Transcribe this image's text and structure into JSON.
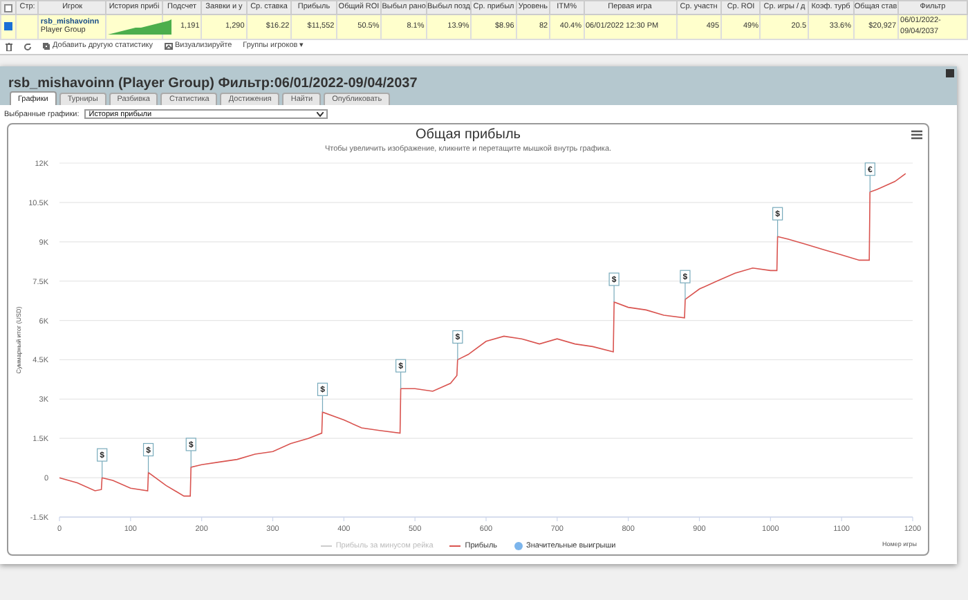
{
  "table": {
    "all_checked": false,
    "columns": [
      "Стр:",
      "Игрок",
      "История прибі",
      "Подсчет",
      "Заявки и у",
      "Ср. ставка",
      "Прибыль",
      "Общий ROI",
      "Выбыл рано",
      "Выбыл позд",
      "Ср. прибыл",
      "Уровень",
      "ITM%",
      "Первая игра",
      "Ср. участн",
      "Ср. ROI",
      "Ср. игры / д",
      "Коэф. турб",
      "Общая став",
      "Фильтр"
    ],
    "rows": [
      {
        "checked": true,
        "player": "rsb_mishavoinn",
        "group": "Player Group",
        "values": [
          "1,191",
          "1,290",
          "$16.22",
          "$11,552",
          "50.5%",
          "8.1%",
          "13.9%",
          "$8.96",
          "82",
          "40.4%",
          "06/01/2022 12:30 PM",
          "495",
          "49%",
          "20.5",
          "33.6%",
          "$20,927",
          "06/01/2022-09/04/2037"
        ]
      }
    ]
  },
  "toolbar": {
    "items": [
      {
        "kind": "trash"
      },
      {
        "kind": "refresh"
      },
      {
        "kind": "add",
        "label": "Добавить другую статистику"
      },
      {
        "kind": "chart",
        "label": "Визуализируйте"
      },
      {
        "kind": "menu",
        "label": "Группы игроков ▾"
      }
    ]
  },
  "panel": {
    "title": "rsb_mishavoinn (Player Group) Фильтр:06/01/2022-09/04/2037",
    "tabs": [
      {
        "label": "Графики",
        "selected": true
      },
      {
        "label": "Турниры",
        "selected": false
      },
      {
        "label": "Разбивка",
        "selected": false
      },
      {
        "label": "Статистика",
        "selected": false
      },
      {
        "label": "Достижения",
        "selected": false
      },
      {
        "label": "Найти",
        "selected": false
      },
      {
        "label": "Опубликовать",
        "selected": false
      }
    ],
    "select": {
      "label": "Выбранные графики:",
      "value": "История прибыли"
    },
    "chart": {
      "subtitle": "Чтобы увеличить изображение, кликните и перетащите мышкой внутрь графика.",
      "legend": [
        {
          "label": "Прибыль за минусом рейка",
          "kind": "line",
          "hidden": true
        },
        {
          "label": "Значительные выигрыши",
          "kind": "dot",
          "hidden": false
        }
      ],
      "chart_data": {
        "type": "line",
        "title": "Общая прибыль",
        "xlabel": "Номер игры",
        "ylabel": "Суммарный итог (USD)",
        "x": [
          0,
          25,
          50,
          59,
          60,
          75,
          100,
          124,
          125,
          150,
          175,
          184,
          185,
          200,
          225,
          250,
          275,
          300,
          325,
          350,
          369,
          370,
          400,
          425,
          450,
          479,
          480,
          500,
          525,
          550,
          559,
          560,
          575,
          600,
          625,
          650,
          675,
          700,
          725,
          750,
          779,
          780,
          800,
          825,
          850,
          879,
          880,
          900,
          925,
          950,
          975,
          1000,
          1009,
          1010,
          1025,
          1050,
          1075,
          1100,
          1125,
          1139,
          1140,
          1150,
          1175,
          1190
        ],
        "series": [
          {
            "name": "Прибыль",
            "color": "#d9534f",
            "values": [
              0,
              -200,
              -500,
              -450,
              0,
              -100,
              -400,
              -500,
              200,
              -300,
              -700,
              -700,
              400,
              500,
              600,
              700,
              900,
              1000,
              1300,
              1500,
              1700,
              2500,
              2200,
              1900,
              1800,
              1700,
              3400,
              3400,
              3300,
              3600,
              3900,
              4500,
              4700,
              5200,
              5400,
              5300,
              5100,
              5300,
              5100,
              5000,
              4800,
              6700,
              6500,
              6400,
              6200,
              6100,
              6800,
              7200,
              7500,
              7800,
              8000,
              7900,
              7900,
              9200,
              9100,
              8900,
              8700,
              8500,
              8300,
              8300,
              10900,
              11000,
              11300,
              11600
            ]
          }
        ],
        "xlim": [
          0,
          1200
        ],
        "ylim": [
          -1500,
          12000
        ],
        "grid": true,
        "xticks": [
          0,
          100,
          200,
          300,
          400,
          500,
          600,
          700,
          800,
          900,
          1000,
          1100,
          1200
        ],
        "yticks": [
          {
            "value": -1500,
            "label": "-1.5K"
          },
          {
            "value": 0,
            "label": "0"
          },
          {
            "value": 1500,
            "label": "1.5K"
          },
          {
            "value": 3000,
            "label": "3K"
          },
          {
            "value": 4500,
            "label": "4.5K"
          },
          {
            "value": 6000,
            "label": "6K"
          },
          {
            "value": 7500,
            "label": "7.5K"
          },
          {
            "value": 9000,
            "label": "9K"
          },
          {
            "value": 10500,
            "label": "10.5K"
          },
          {
            "value": 12000,
            "label": "12K"
          }
        ],
        "annotations": [
          {
            "x": 60,
            "y": 0,
            "text": "$"
          },
          {
            "x": 125,
            "y": 200,
            "text": "$"
          },
          {
            "x": 185,
            "y": 400,
            "text": "$"
          },
          {
            "x": 370,
            "y": 2500,
            "text": "$"
          },
          {
            "x": 480,
            "y": 3400,
            "text": "$"
          },
          {
            "x": 560,
            "y": 4500,
            "text": "$"
          },
          {
            "x": 780,
            "y": 6700,
            "text": "$"
          },
          {
            "x": 880,
            "y": 6800,
            "text": "$"
          },
          {
            "x": 1010,
            "y": 9200,
            "text": "$"
          },
          {
            "x": 1140,
            "y": 10900,
            "text": "€"
          }
        ]
      }
    }
  }
}
